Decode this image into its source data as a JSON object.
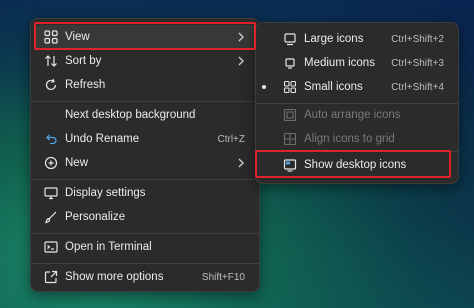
{
  "main_menu": {
    "items": [
      {
        "label": "View",
        "icon": "grid-icon",
        "has_submenu": true
      },
      {
        "label": "Sort by",
        "icon": "sort-icon",
        "has_submenu": true
      },
      {
        "label": "Refresh",
        "icon": "refresh-icon"
      },
      {
        "label": "Next desktop background",
        "icon": ""
      },
      {
        "label": "Undo Rename",
        "icon": "undo-icon",
        "shortcut": "Ctrl+Z"
      },
      {
        "label": "New",
        "icon": "new-icon",
        "has_submenu": true
      },
      {
        "label": "Display settings",
        "icon": "display-icon"
      },
      {
        "label": "Personalize",
        "icon": "brush-icon"
      },
      {
        "label": "Open in Terminal",
        "icon": "terminal-icon"
      },
      {
        "label": "Show more options",
        "icon": "share-icon",
        "shortcut": "Shift+F10"
      }
    ]
  },
  "view_submenu": {
    "items": [
      {
        "label": "Large icons",
        "icon": "large-icons-icon",
        "shortcut": "Ctrl+Shift+2"
      },
      {
        "label": "Medium icons",
        "icon": "medium-icons-icon",
        "shortcut": "Ctrl+Shift+3"
      },
      {
        "label": "Small icons",
        "icon": "small-icons-icon",
        "shortcut": "Ctrl+Shift+4",
        "selected": true
      },
      {
        "label": "Auto arrange icons",
        "icon": "auto-arrange-icon",
        "disabled": true
      },
      {
        "label": "Align icons to grid",
        "icon": "align-grid-icon",
        "disabled": true
      },
      {
        "label": "Show desktop icons",
        "icon": "show-desktop-icon"
      }
    ]
  },
  "colors": {
    "menu_bg": "#2b2b2b",
    "highlight_box": "#e0232b",
    "text": "#ececec",
    "disabled_text": "#7a7a7a"
  }
}
